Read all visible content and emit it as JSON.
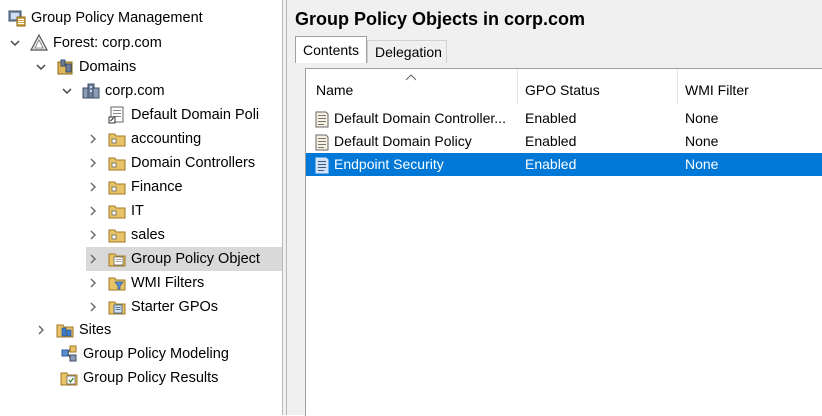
{
  "tree": {
    "root": {
      "label": "Group Policy Management",
      "icon": "gpm-console-icon"
    },
    "forest": {
      "label": "Forest: corp.com",
      "icon": "forest-icon"
    },
    "domains": {
      "label": "Domains",
      "icon": "domains-icon"
    },
    "domain": {
      "label": "corp.com",
      "icon": "domain-icon"
    },
    "items": [
      {
        "label": "Default Domain Poli",
        "icon": "gpo-link-icon"
      },
      {
        "label": "accounting",
        "icon": "ou-folder-icon"
      },
      {
        "label": "Domain Controllers",
        "icon": "ou-folder-icon"
      },
      {
        "label": "Finance",
        "icon": "ou-folder-icon"
      },
      {
        "label": "IT",
        "icon": "ou-folder-icon"
      },
      {
        "label": "sales",
        "icon": "ou-folder-icon"
      },
      {
        "label": "Group Policy Object",
        "icon": "gpo-container-icon"
      },
      {
        "label": "WMI Filters",
        "icon": "wmi-filters-icon"
      },
      {
        "label": "Starter GPOs",
        "icon": "starter-gpos-icon"
      }
    ],
    "sites": {
      "label": "Sites",
      "icon": "sites-icon"
    },
    "modeling": {
      "label": "Group Policy Modeling",
      "icon": "gp-modeling-icon"
    },
    "results": {
      "label": "Group Policy Results",
      "icon": "gp-results-icon"
    }
  },
  "main": {
    "title": "Group Policy Objects in corp.com",
    "tabs": [
      {
        "label": "Contents"
      },
      {
        "label": "Delegation"
      }
    ],
    "columns": [
      {
        "label": "Name"
      },
      {
        "label": "GPO Status"
      },
      {
        "label": "WMI Filter"
      }
    ],
    "rows": [
      {
        "name": "Default Domain Controller...",
        "status": "Enabled",
        "wmi": "None"
      },
      {
        "name": "Default Domain Policy",
        "status": "Enabled",
        "wmi": "None"
      },
      {
        "name": "Endpoint Security",
        "status": "Enabled",
        "wmi": "None"
      }
    ]
  },
  "colors": {
    "selection": "#0078d7",
    "tree_selection": "#d9d9d9",
    "pane_bg": "#f0f0f0"
  }
}
